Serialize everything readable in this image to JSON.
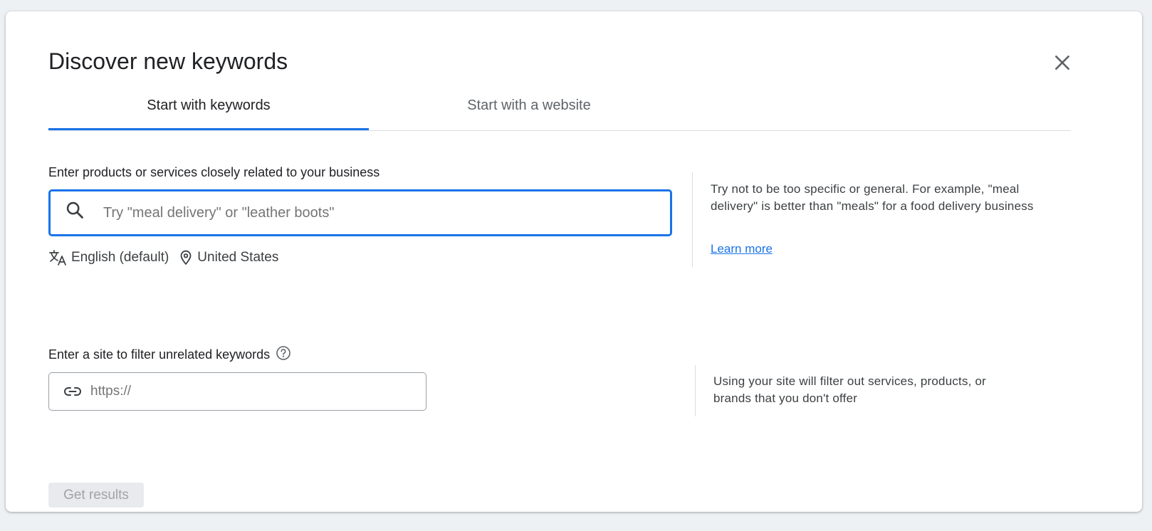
{
  "dialog": {
    "title": "Discover new keywords"
  },
  "tabs": [
    {
      "label": "Start with keywords",
      "active": true
    },
    {
      "label": "Start with a website",
      "active": false
    }
  ],
  "products_section": {
    "label": "Enter products or services closely related to your business",
    "input_value": "",
    "input_placeholder": "Try \"meal delivery\" or \"leather boots\"",
    "language": "English (default)",
    "location": "United States",
    "help_text": "Try not to be too specific or general. For example, \"meal delivery\" is better than \"meals\" for a food delivery business",
    "learn_more": "Learn more"
  },
  "site_section": {
    "label": "Enter a site to filter unrelated keywords",
    "input_value": "",
    "input_placeholder": "https://",
    "help_text": "Using your site will filter out services, products, or brands that you don't offer"
  },
  "actions": {
    "get_results": "Get results",
    "get_results_enabled": false
  },
  "icons": {
    "close": "close-icon",
    "search": "search-icon",
    "translate": "translate-icon",
    "location": "location-pin-icon",
    "help": "help-circle-icon",
    "link": "link-icon"
  },
  "colors": {
    "accent": "#1a73e8",
    "text_primary": "#202124",
    "text_secondary": "#5f6368",
    "disabled_bg": "#e8eaed",
    "disabled_text": "#a0a4a8"
  }
}
